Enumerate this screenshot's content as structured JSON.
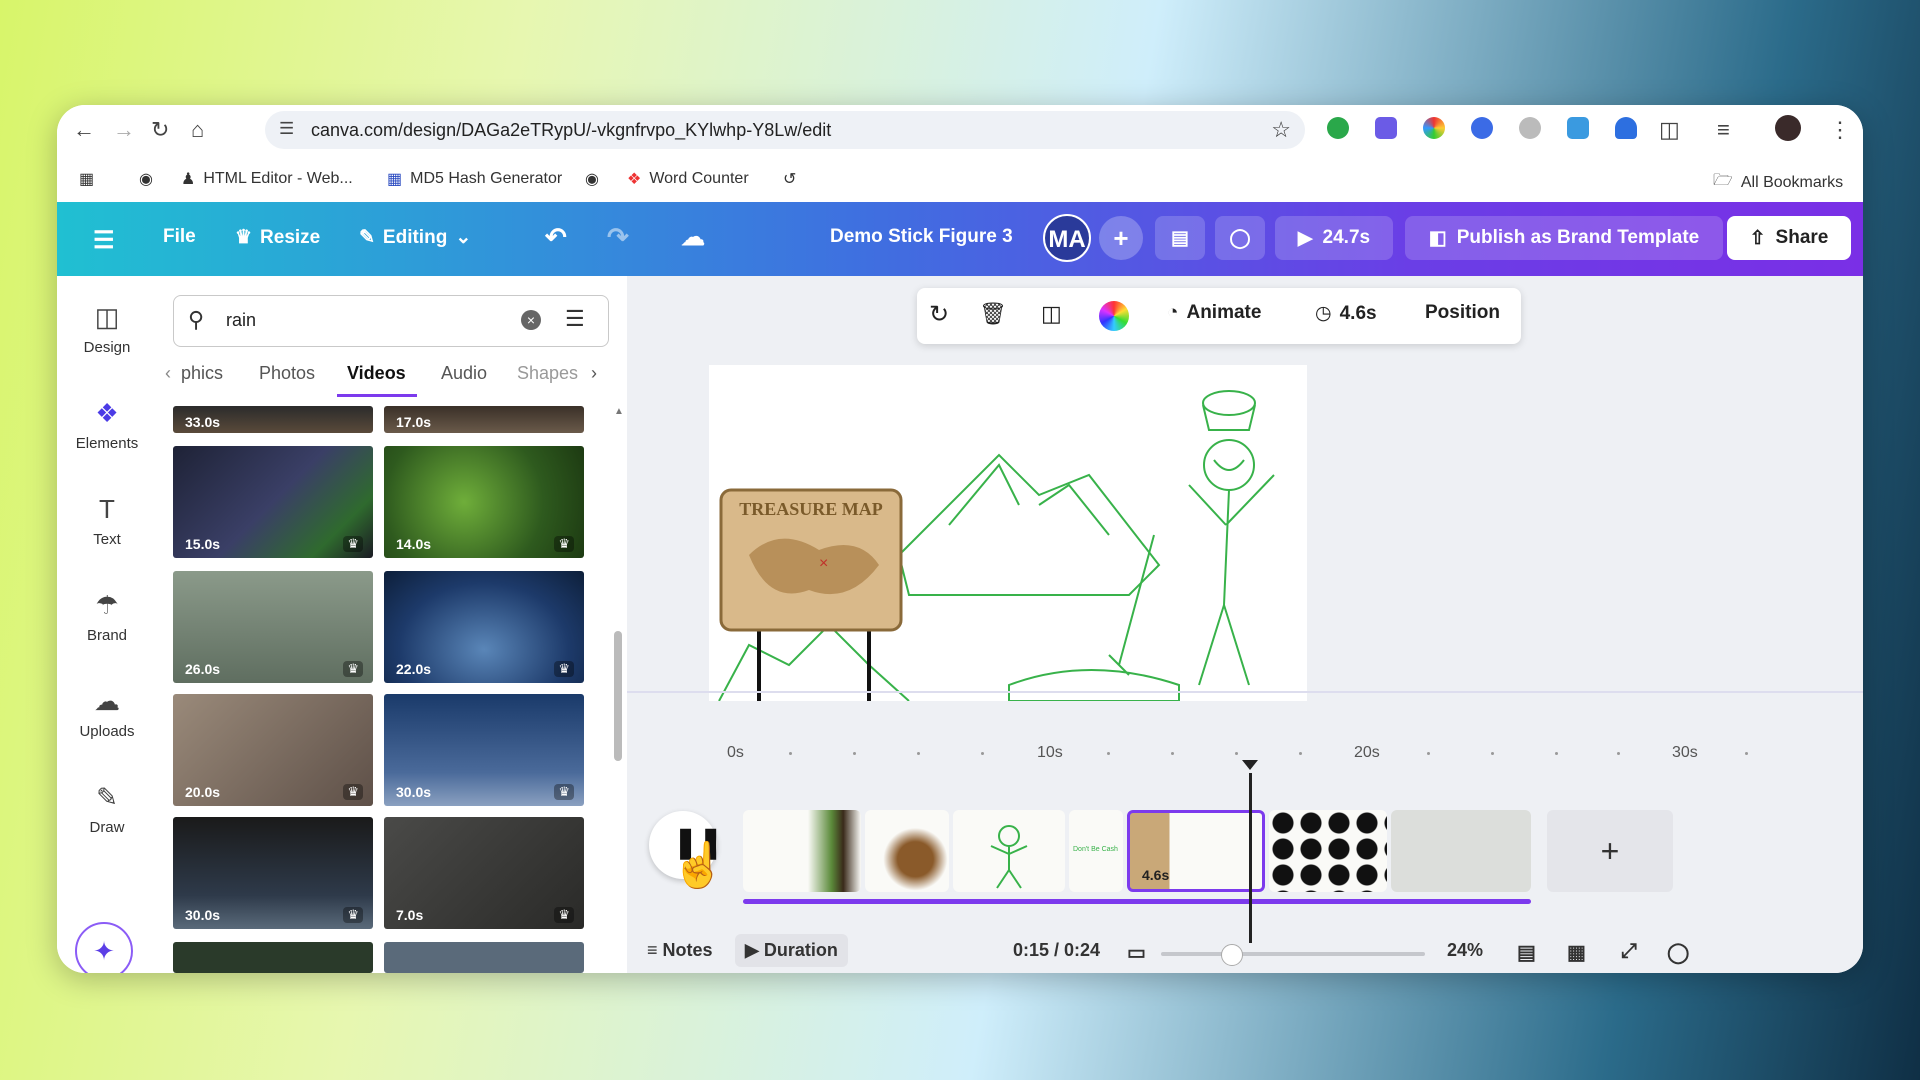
{
  "browser": {
    "url": "canva.com/design/DAGa2eTRypU/-vkgnfrvpo_KYlwhp-Y8Lw/edit",
    "bookmarks": [
      "HTML Editor - Web...",
      "MD5 Hash Generator",
      "Word Counter"
    ],
    "all_bookmarks": "All Bookmarks"
  },
  "topbar": {
    "file": "File",
    "resize": "Resize",
    "editing": "Editing",
    "title": "Demo Stick Figure 3",
    "avatar": "MA",
    "play_time": "24.7s",
    "publish": "Publish as Brand Template",
    "share": "Share"
  },
  "rail": {
    "items": [
      {
        "label": "Design",
        "icon": "design-icon"
      },
      {
        "label": "Elements",
        "icon": "elements-icon"
      },
      {
        "label": "Text",
        "icon": "text-icon"
      },
      {
        "label": "Brand",
        "icon": "brand-icon"
      },
      {
        "label": "Uploads",
        "icon": "uploads-icon"
      },
      {
        "label": "Draw",
        "icon": "draw-icon"
      }
    ]
  },
  "panel": {
    "search_value": "rain",
    "tabs": [
      "phics",
      "Photos",
      "Videos",
      "Audio",
      "Shapes"
    ],
    "active_tab": "Videos",
    "videos": [
      {
        "duration": "33.0s"
      },
      {
        "duration": "17.0s"
      },
      {
        "duration": "15.0s"
      },
      {
        "duration": "14.0s"
      },
      {
        "duration": "26.0s"
      },
      {
        "duration": "22.0s"
      },
      {
        "duration": "20.0s"
      },
      {
        "duration": "30.0s"
      },
      {
        "duration": "30.0s"
      },
      {
        "duration": "7.0s"
      }
    ]
  },
  "context_toolbar": {
    "animate": "Animate",
    "duration": "4.6s",
    "position": "Position"
  },
  "canvas": {
    "sign_text": "TREASURE MAP"
  },
  "timeline": {
    "labels": [
      "0s",
      "10s",
      "20s",
      "30s"
    ],
    "selected_clip_duration": "4.6s",
    "clip_text": "Don't Be Cash"
  },
  "bottom": {
    "notes": "Notes",
    "duration": "Duration",
    "time": "0:15 / 0:24",
    "zoom": "24%"
  },
  "colors": {
    "accent": "#7c3aed",
    "topbar_start": "#20c0d2",
    "topbar_end": "#7a2fe6",
    "drawing_green": "#38b24a"
  }
}
